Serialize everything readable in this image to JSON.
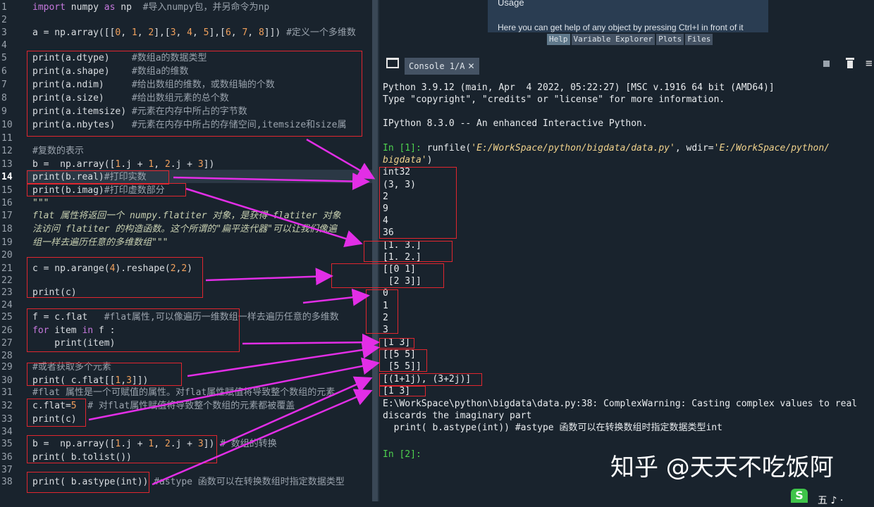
{
  "editor": {
    "line_numbers": [
      "1",
      "2",
      "3",
      "4",
      "5",
      "6",
      "7",
      "8",
      "9",
      "10",
      "11",
      "12",
      "13",
      "14",
      "15",
      "16",
      "17",
      "18",
      "19",
      "20",
      "21",
      "22",
      "23",
      "24",
      "25",
      "26",
      "27",
      "28",
      "29",
      "30",
      "31",
      "32",
      "33",
      "34",
      "35",
      "36",
      "37",
      "38"
    ],
    "lines": {
      "l1_kw1": "import",
      "l1_mid": " numpy ",
      "l1_kw2": "as",
      "l1_rest": " np  ",
      "l1_cmt": "#导入numpy包，并另命令为np",
      "l3_a": "a = np.array([[",
      "l3_n1": "0",
      "l3_c1": ", ",
      "l3_n2": "1",
      "l3_c2": ", ",
      "l3_n3": "2",
      "l3_b": "],[",
      "l3_n4": "3",
      "l3_c3": ", ",
      "l3_n5": "4",
      "l3_c4": ", ",
      "l3_n6": "5",
      "l3_b2": "],[",
      "l3_n7": "6",
      "l3_c5": ", ",
      "l3_n8": "7",
      "l3_c6": ", ",
      "l3_n9": "8",
      "l3_end": "]]) ",
      "l3_cmt": "#定义一个多维数",
      "l5": "print(a.dtype)    ",
      "l5_cmt": "#数组a的数据类型",
      "l6": "print(a.shape)    ",
      "l6_cmt": "#数组a的维数",
      "l7": "print(a.ndim)     ",
      "l7_cmt": "#给出数组的维数，或数组轴的个数",
      "l8": "print(a.size)     ",
      "l8_cmt": "#给出数组元素的总个数",
      "l9": "print(a.itemsize) ",
      "l9_cmt": "#元素在内存中所占的字节数",
      "l10": "print(a.nbytes)   ",
      "l10_cmt": "#元素在内存中所占的存储空间,itemsize和size属",
      "l12_cmt": "#复数的表示",
      "l13_a": "b =  np.array([",
      "l13_n1": "1",
      "l13_b": ".j + ",
      "l13_n2": "1",
      "l13_c": ", ",
      "l13_n3": "2",
      "l13_d": ".j + ",
      "l13_n4": "3",
      "l13_e": "])",
      "l14": "print(b.real)",
      "l14_cmt": "#打印实数",
      "l15": "print(b.imag)",
      "l15_cmt": "#打印虚数部分",
      "l16": "\"\"\"",
      "l17": "flat 属性将返回一个 numpy.flatiter 对象，是获得 flatiter 对象",
      "l18": "法访问 flatiter 的构造函数。这个所谓的\"扁平迭代器\"可以让我们像遍",
      "l19": "组一样去遍历任意的多维数组\"\"\"",
      "l21_a": "c = np.arange(",
      "l21_n1": "4",
      "l21_b": ").reshape(",
      "l21_n2": "2",
      "l21_c": ",",
      "l21_n3": "2",
      "l21_d": ")",
      "l23": "print(c)",
      "l25": "f = c.flat   ",
      "l25_cmt": "#flat属性,可以像遍历一维数组一样去遍历任意的多维数",
      "l26_kw1": "for",
      "l26_mid": " item ",
      "l26_kw2": "in",
      "l26_rest": " f :",
      "l27": "    print(item)",
      "l29_cmt": "#或者获取多个元素",
      "l30_a": "print( c.flat[[",
      "l30_n1": "1",
      "l30_b": ",",
      "l30_n2": "3",
      "l30_c": "]])",
      "l31_cmt": "#flat 属性是一个可赋值的属性。对flat属性赋值将导致整个数组的元素",
      "l32_a": "c.flat=",
      "l32_n": "5",
      "l32_cmt": "  # 对flat属性赋值将导致整个数组的元素都被覆盖",
      "l33": "print(c)",
      "l35_a": "b =  np.array([",
      "l35_n1": "1",
      "l35_b": ".j + ",
      "l35_n2": "1",
      "l35_c": ", ",
      "l35_n3": "2",
      "l35_d": ".j + ",
      "l35_n4": "3",
      "l35_e": "]) ",
      "l35_cmt": "# 数组的转换",
      "l36": "print( b.tolist())",
      "l38": "print( b.astype(int)) ",
      "l38_cmt": "#astype 函数可以在转换数组时指定数据类型"
    }
  },
  "help_pane": {
    "title": "Usage",
    "text": "Here you can get help of any object by pressing Ctrl+I in front of it",
    "tabs": [
      "Help",
      "Variable Explorer",
      "Plots",
      "Files"
    ]
  },
  "console": {
    "tab_label": "Console 1/A",
    "lines": {
      "c1": "Python 3.9.12 (main, Apr  4 2022, 05:22:27) [MSC v.1916 64 bit (AMD64)]",
      "c2": "Type \"copyright\", \"credits\" or \"license\" for more information.",
      "c3": "IPython 8.3.0 -- An enhanced Interactive Python.",
      "p1_prompt": "In [1]:",
      "p1_cmd": " runfile(",
      "p1_path1": "'E:/WorkSpace/python/bigdata/data.py'",
      "p1_mid": ", wdir=",
      "p1_path2": "'E:/WorkSpace/python/",
      "p1_path3": "bigdata'",
      "p1_end": ")",
      "o1": "int32",
      "o2": "(3, 3)",
      "o3": "2",
      "o4": "9",
      "o5": "4",
      "o6": "36",
      "o7": "[1. 3.]",
      "o8": "[1. 2.]",
      "o9": "[[0 1]",
      "o10": " [2 3]]",
      "o11": "0",
      "o12": "1",
      "o13": "2",
      "o14": "3",
      "o15": "[1 3]",
      "o16": "[[5 5]",
      "o17": " [5 5]]",
      "o18": "[(1+1j), (3+2j)]",
      "o19": "[1 3]",
      "w1": "E:\\WorkSpace\\python\\bigdata\\data.py:38: ComplexWarning: Casting complex values to real",
      "w2": "discards the imaginary part",
      "w3": "  print( b.astype(int)) #astype 函数可以在转换数组时指定数据类型int",
      "p2_prompt": "In [2]:"
    }
  },
  "watermark": "知乎 @天天不吃饭阿",
  "tray": {
    "logo": "S",
    "text": "五 ♪ ·"
  },
  "colors": {
    "bg": "#19232d",
    "annotation_red": "#e0262f",
    "arrow_magenta": "#e22ee6",
    "prompt_green": "#4ed24e"
  }
}
